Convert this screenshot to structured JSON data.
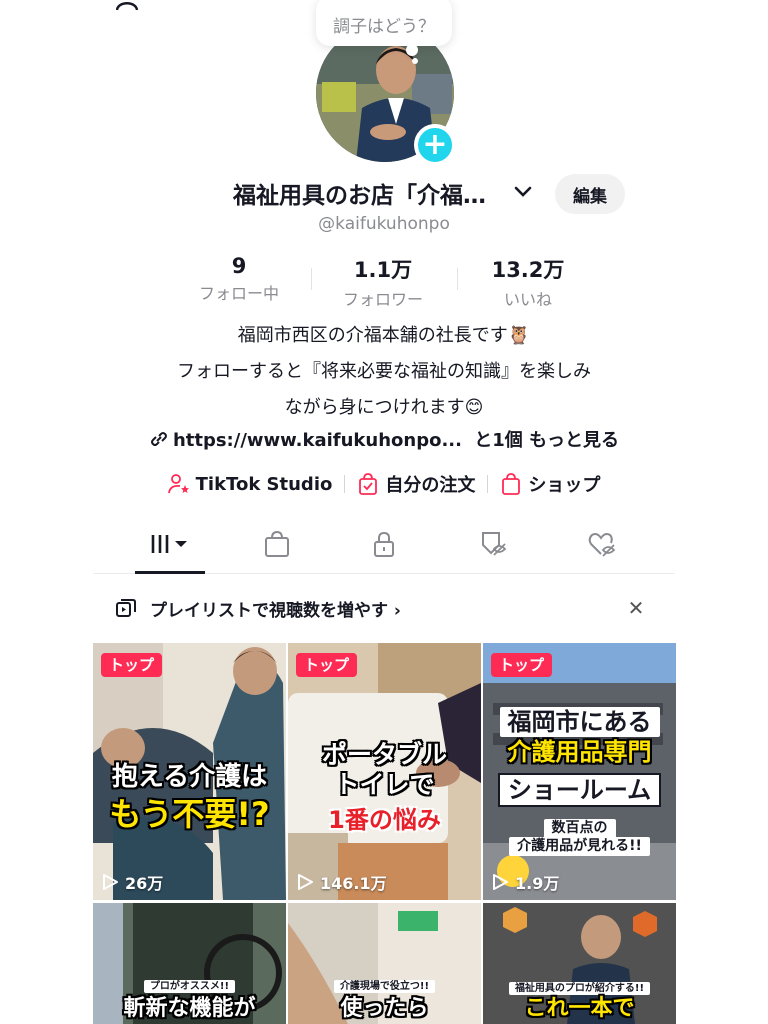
{
  "status_prompt": "調子はどう？",
  "profile": {
    "display_name": "福祉用具のお店「介福…",
    "edit_label": "編集",
    "handle": "@kaifukuhonpo"
  },
  "stats": [
    {
      "value": "9",
      "label": "フォロー中"
    },
    {
      "value": "1.1万",
      "label": "フォロワー"
    },
    {
      "value": "13.2万",
      "label": "いいね"
    }
  ],
  "bio": {
    "line1": "福岡市西区の介福本舗の社長です🦉",
    "line2": "フォローすると『将来必要な福祉の知識』を楽しみ",
    "line3": "ながら身につけれます😊"
  },
  "link": {
    "url": "https://www.kaifukuhonpo...",
    "more": "と1個 もっと見る"
  },
  "actions": [
    {
      "label": "TikTok Studio",
      "icon": "person-star-icon"
    },
    {
      "label": "自分の注文",
      "icon": "order-bag-icon"
    },
    {
      "label": "ショップ",
      "icon": "shop-bag-icon"
    }
  ],
  "tabs": [
    "videos-grid-icon",
    "shop-bag-icon",
    "lock-icon",
    "reposts-icon",
    "liked-icon"
  ],
  "playlist_prompt": "プレイリストで視聴数を増やす ›",
  "videos": [
    {
      "pin": "トップ",
      "views": "26万",
      "caption1": "抱える介護は",
      "caption2": "もう不要!?"
    },
    {
      "pin": "トップ",
      "views": "146.1万",
      "caption1": "ポータブル",
      "caption2": "トイレで",
      "caption3": "1番の悩み"
    },
    {
      "pin": "トップ",
      "views": "1.9万",
      "caption1": "福岡市にある",
      "caption2": "介護用品専門",
      "caption3": "ショールーム",
      "caption4": "数百点の",
      "caption5": "介護用品が見れる!!"
    },
    {
      "small": "プロがオススメ!!",
      "caption1": "斬新な機能が"
    },
    {
      "small": "介護現場で役立つ!!",
      "caption1": "使ったら"
    },
    {
      "small": "福祉用具のプロが紹介する!!",
      "caption1": "これ一本で"
    }
  ],
  "colors": {
    "accent": "#fe2c55",
    "plus": "#20d5ec",
    "muted": "#8a8b91"
  }
}
